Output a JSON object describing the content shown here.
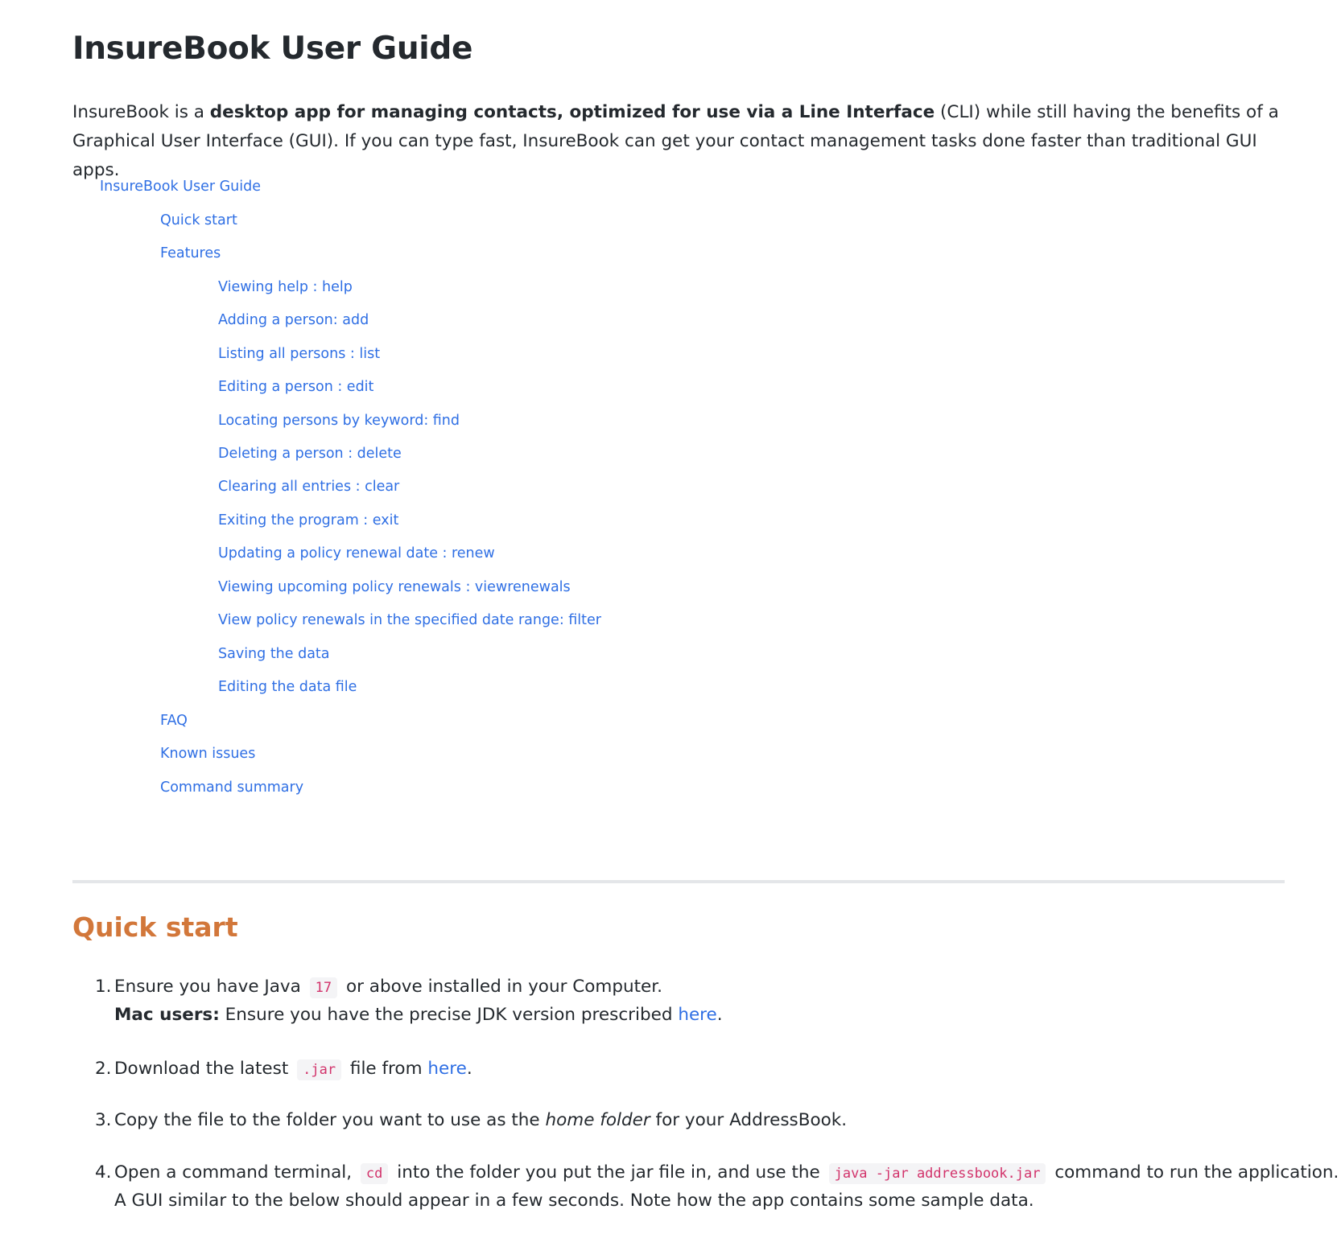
{
  "title": "InsureBook User Guide",
  "intro": {
    "p1": "InsureBook is a ",
    "bold": "desktop app for managing contacts, optimized for use via a Line Interface",
    "p2": " (CLI) while still having the benefits of a Graphical User Interface (GUI). If you can type fast, InsureBook can get your contact management tasks done faster than traditional GUI apps."
  },
  "toc": {
    "root": "InsureBook User Guide",
    "quick_start": "Quick start",
    "features": "Features",
    "feature_items": [
      "Viewing help : help",
      "Adding a person: add",
      "Listing all persons : list",
      "Editing a person : edit",
      "Locating persons by keyword: find",
      "Deleting a person : delete",
      "Clearing all entries : clear",
      "Exiting the program : exit",
      "Updating a policy renewal date : renew",
      "Viewing upcoming policy renewals : viewrenewals",
      "View policy renewals in the specified date range: filter",
      "Saving the data",
      "Editing the data file"
    ],
    "faq": "FAQ",
    "known_issues": "Known issues",
    "command_summary": "Command summary"
  },
  "quick_start": {
    "heading": "Quick start",
    "steps": [
      {
        "num": "1.",
        "a": "Ensure you have Java",
        "code": "17",
        "b": "or above installed in your Computer.",
        "mac_label": "Mac users:",
        "mac_text": " Ensure you have the precise JDK version prescribed ",
        "mac_link": "here",
        "mac_end": "."
      },
      {
        "num": "2.",
        "a": "Download the latest",
        "code": ".jar",
        "b": "file from ",
        "link": "here",
        "end": "."
      },
      {
        "num": "3.",
        "a": "Copy the file to the folder you want to use as the ",
        "em": "home folder",
        "b": " for your AddressBook."
      },
      {
        "num": "4.",
        "a": "Open a command terminal,",
        "code1": "cd",
        "b": "into the folder you put the jar file in, and use the",
        "code2": "java -jar addressbook.jar",
        "c": "command to run the application.",
        "line2": "A GUI similar to the below should appear in a few seconds. Note how the app contains some sample data."
      }
    ]
  },
  "colors": {
    "link": "#2f6fe4",
    "section_heading": "#d2773a",
    "code_text": "#d2336b",
    "divider": "#e4e6e9"
  }
}
